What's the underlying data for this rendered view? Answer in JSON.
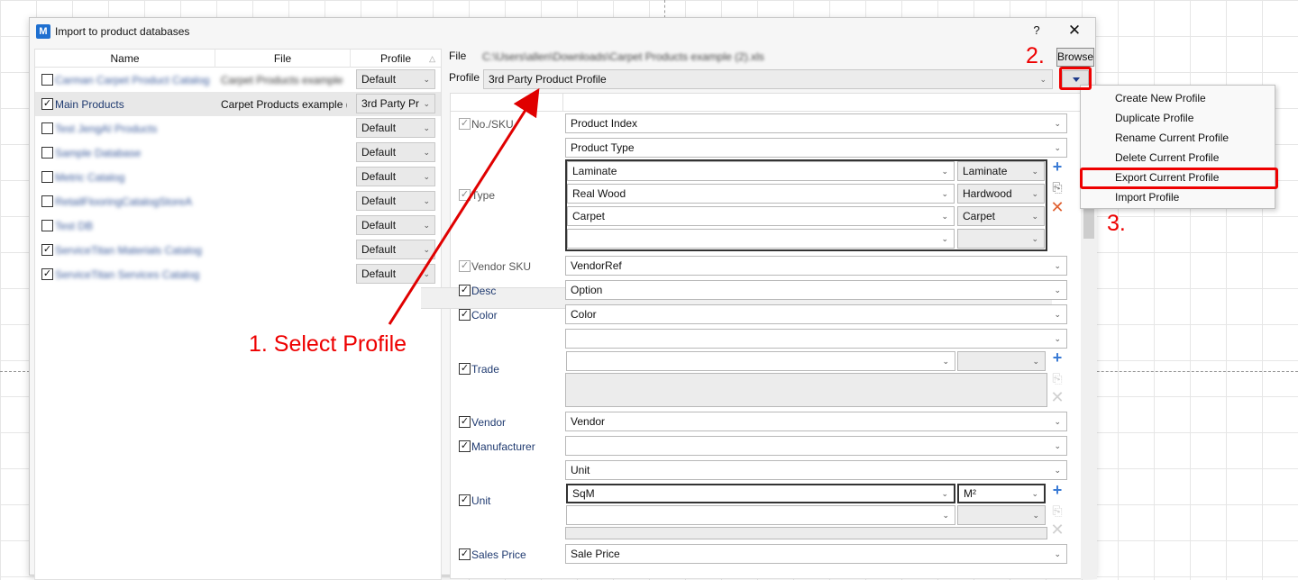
{
  "dialog": {
    "title": "Import to product databases",
    "app_icon_text": "M",
    "help_label": "?",
    "close_label": "✕"
  },
  "grid": {
    "headers": {
      "name": "Name",
      "file": "File",
      "profile": "Profile"
    },
    "rows": [
      {
        "checked": false,
        "name": "Carman Carpet Product Catalog",
        "file": "Carpet Products example",
        "profile": "Default",
        "blurred": true
      },
      {
        "checked": true,
        "name": "Main Products",
        "file": "Carpet Products example (",
        "profile": "3rd Party Pr",
        "blurred": false,
        "selected": true
      },
      {
        "checked": false,
        "name": "Test JengAI Products",
        "file": "",
        "profile": "Default",
        "blurred": true
      },
      {
        "checked": false,
        "name": "Sample Database",
        "file": "",
        "profile": "Default",
        "blurred": true
      },
      {
        "checked": false,
        "name": "Metric Catalog",
        "file": "",
        "profile": "Default",
        "blurred": true
      },
      {
        "checked": false,
        "name": "RetailFlooringCatalogStoreA",
        "file": "",
        "profile": "Default",
        "blurred": true
      },
      {
        "checked": false,
        "name": "Test DB",
        "file": "",
        "profile": "Default",
        "blurred": true
      },
      {
        "checked": true,
        "name": "ServiceTitan Materials Catalog",
        "file": "",
        "profile": "Default",
        "blurred": true
      },
      {
        "checked": true,
        "name": "ServiceTitan Services Catalog",
        "file": "",
        "profile": "Default",
        "blurred": true
      }
    ]
  },
  "right": {
    "file_label": "File",
    "file_path": "C:\\Users\\allen\\Downloads\\Carpet Products example (2).xls",
    "browse_label": "Browse",
    "profile_label": "Profile",
    "profile_value": "3rd Party Product Profile"
  },
  "fields": {
    "no_sku": {
      "label": "No./SKU",
      "value": "Product Index"
    },
    "type": {
      "label": "Type",
      "header_value": "Product Type",
      "mappings": [
        {
          "source": "Laminate",
          "target": "Laminate"
        },
        {
          "source": "Real Wood",
          "target": "Hardwood"
        },
        {
          "source": "Carpet",
          "target": "Carpet"
        }
      ]
    },
    "vendor_sku": {
      "label": "Vendor SKU",
      "value": "VendorRef"
    },
    "desc": {
      "label": "Desc",
      "value": "Option"
    },
    "color": {
      "label": "Color",
      "value": "Color"
    },
    "trade": {
      "label": "Trade"
    },
    "vendor": {
      "label": "Vendor",
      "value": "Vendor"
    },
    "manufacturer": {
      "label": "Manufacturer",
      "value": ""
    },
    "unit": {
      "label": "Unit",
      "header_value": "Unit",
      "mappings": [
        {
          "source": "SqM",
          "target": "M²"
        }
      ]
    },
    "sales_price": {
      "label": "Sales Price",
      "value": "Sale Price"
    }
  },
  "menu": {
    "items": [
      "Create New Profile",
      "Duplicate Profile",
      "Rename Current Profile",
      "Delete Current Profile",
      "Export Current Profile",
      "Import Profile"
    ]
  },
  "annotations": {
    "step1": "1. Select Profile",
    "step2": "2.",
    "step3": "3."
  },
  "colors": {
    "annotation_red": "#e00000",
    "link_blue": "#1f3a70",
    "add_icon_blue": "#3a7bd5"
  }
}
